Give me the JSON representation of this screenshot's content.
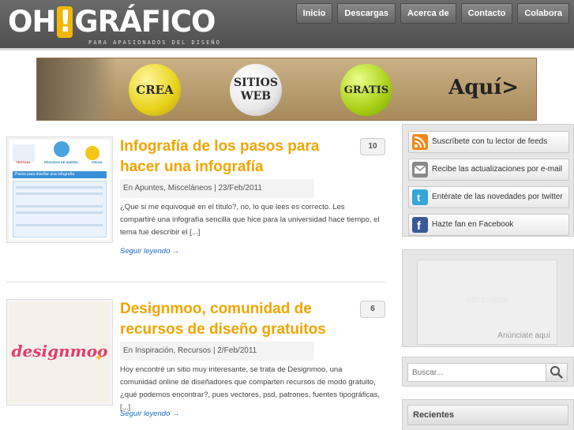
{
  "site": {
    "logo_left": "OH",
    "logo_bang": "!",
    "logo_right": "GRÁFICO",
    "tagline": "PARA APASIONADOS DEL DISEÑO"
  },
  "nav": [
    "Inicio",
    "Descargas",
    "Acerca de",
    "Contacto",
    "Colabora"
  ],
  "banner": {
    "badge1": "CREA",
    "badge2_line1": "SITIOS",
    "badge2_line2": "WEB",
    "badge3": "GRATIS",
    "cta": "Aquí>"
  },
  "posts": [
    {
      "title": "Infografía de los pasos para hacer una infografía",
      "comments": "10",
      "meta_prefix": "En",
      "cat1": "Apuntes",
      "cat2": "Misceláneos",
      "date": "23/Feb/2011",
      "excerpt": "¿Que si me equivoqué en el título?, no, lo que lees es correcto. Les compartiré una infografía sencilla que hice para la universidad hace tiempo, el tema fue describir el [...]",
      "more": "Seguir leyendo →",
      "thumb_text1": "Pasos para diseñar una infografía",
      "thumb_labels": [
        "TEXTUAL",
        "PROCESO DE DISEÑO",
        "VISUAL"
      ]
    },
    {
      "title": "Designmoo, comunidad de recursos de diseño gratuitos",
      "comments": "6",
      "meta_prefix": "En",
      "cat1": "Inspiración",
      "cat2": "Recursos",
      "date": "2/Feb/2011",
      "excerpt": "Hoy encontré un sitio muy interesante, se trata de Designmoo, una comunidad online de diseñadores que comparten recursos de modo gratuito, ¿qué podemos encontrar?, pues vectores, psd, patrones, fuentes tipográficas, [...]",
      "more": "Seguir leyendo →",
      "thumb_text1": "designmoo"
    }
  ],
  "sidebar": {
    "feeds": [
      {
        "label": "Suscríbete con tu lector de feeds",
        "icon": "rss-icon",
        "color": "#f08a1c"
      },
      {
        "label": "Recibe las actualizaciones por e-mail",
        "icon": "email-icon",
        "color": "#888888"
      },
      {
        "label": "Entérate de las novedades por twitter",
        "icon": "twitter-icon",
        "color": "#35a6d8"
      },
      {
        "label": "Hazte fan en Facebook",
        "icon": "facebook-icon",
        "color": "#3b5998"
      }
    ],
    "ad": {
      "size": "200 x 125px",
      "cta": "Anúnciate aquí"
    },
    "search": {
      "placeholder": "Buscar..."
    },
    "recent_title": "Recientes"
  }
}
